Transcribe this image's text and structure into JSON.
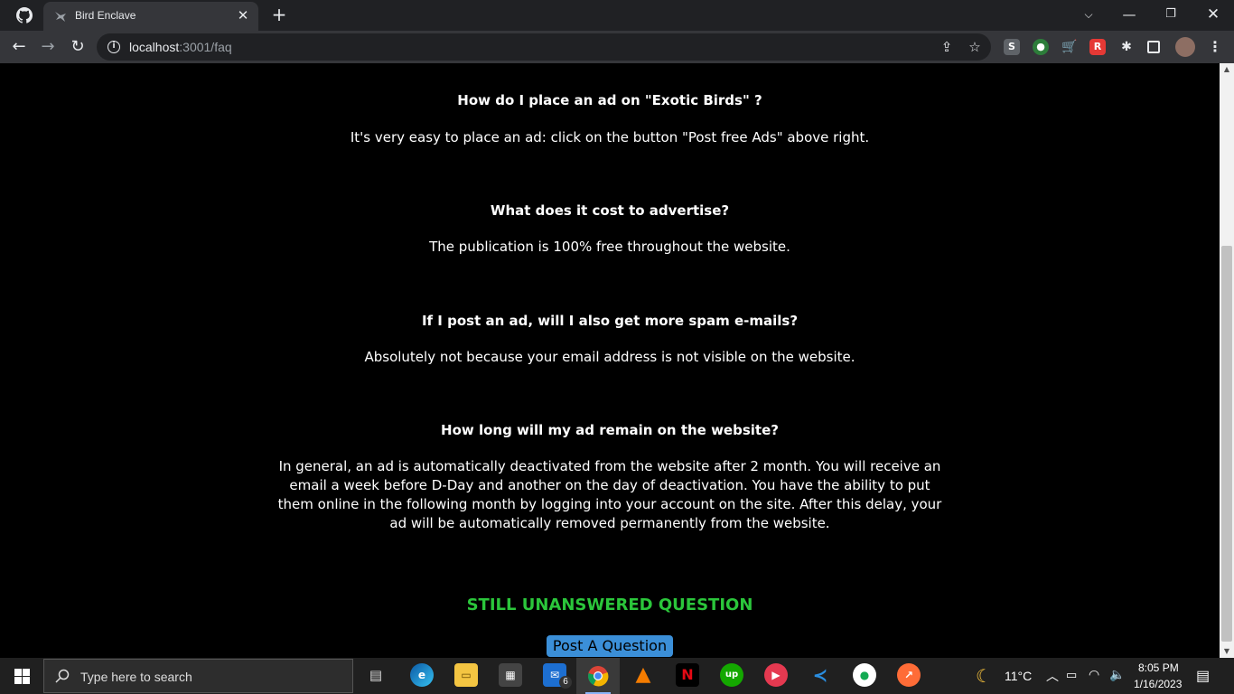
{
  "browser": {
    "tab_title": "Bird Enclave",
    "url_host": "localhost",
    "url_rest": ":3001/faq"
  },
  "faq": [
    {
      "question": "How do I place an ad on \"Exotic Birds\" ?",
      "answer": "It's very easy to place an ad: click on the button \"Post free Ads\" above right."
    },
    {
      "question": "What does it cost to advertise?",
      "answer": "The publication is 100% free throughout the website."
    },
    {
      "question": "If I post an ad, will I also get more spam e-mails?",
      "answer": "Absolutely not because your email address is not visible on the website."
    },
    {
      "question": "How long will my ad remain on the website?",
      "answer": "In general, an ad is automatically deactivated from the website after 2 month. You will receive an email a week before D-Day and another on the day of deactivation. You have the ability to put them online in the following month by logging into your account on the site. After this delay, your ad will be automatically removed permanently from the website."
    }
  ],
  "cta": {
    "heading": "STILL UNANSWERED QUESTION",
    "button_label": "Post A Question"
  },
  "taskbar": {
    "search_placeholder": "Type here to search",
    "mail_badge": "6",
    "weather": "11°C",
    "time": "8:05 PM",
    "date": "1/16/2023"
  },
  "colors": {
    "accent_green": "#2bc63b",
    "button_blue": "#3b8fd8"
  }
}
